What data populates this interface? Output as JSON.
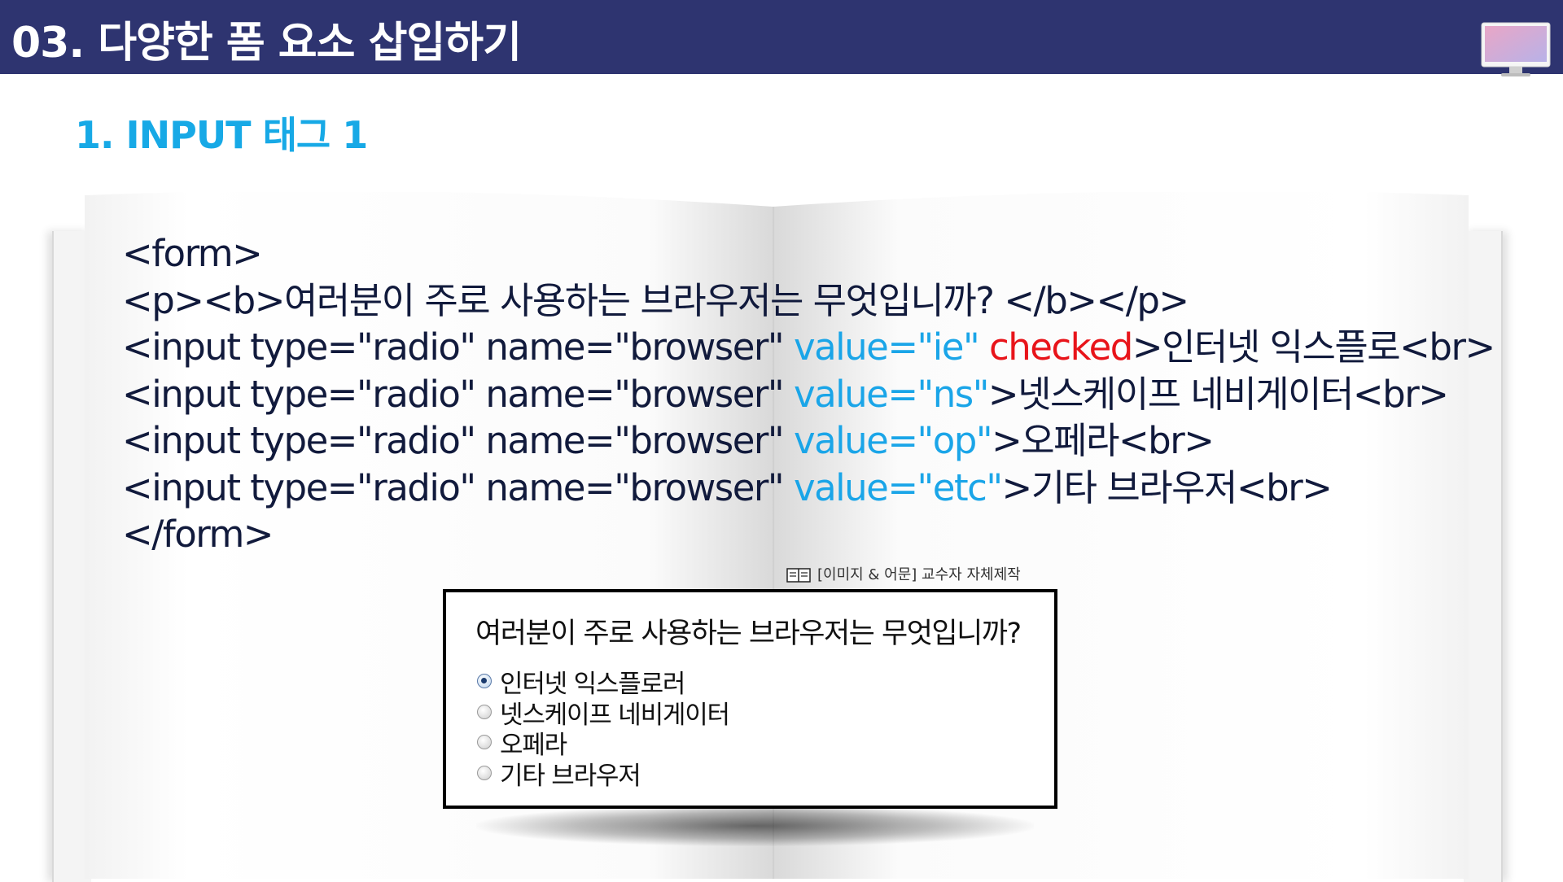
{
  "header": {
    "title": "03. 다양한 폼 요소 삽입하기",
    "icon": "monitor-icon"
  },
  "section": {
    "title": "1. INPUT 태그 1"
  },
  "code": {
    "line1": "<form>",
    "line2": "<p><b>여러분이 주로 사용하는 브라우저는 무엇입니까? </b></p>",
    "line3_a": "<input type=\"radio\" name=\"browser\" ",
    "line3_b": "value=\"ie\" ",
    "line3_c": "checked",
    "line3_d": ">인터넷 익스플로<br>",
    "line4_a": "<input type=\"radio\" name=\"browser\" ",
    "line4_b": "value=\"ns\"",
    "line4_c": ">넷스케이프 네비게이터<br>",
    "line5_a": "<input type=\"radio\" name=\"browser\" ",
    "line5_b": "value=\"op\"",
    "line5_c": ">오페라<br>",
    "line6_a": "<input type=\"radio\" name=\"browser\" ",
    "line6_b": "value=\"etc\"",
    "line6_c": ">기타 브라우저<br>",
    "line7": "</form>"
  },
  "credit": {
    "text": "[이미지 & 어문] 교수자 자체제작",
    "icon": "book-icon"
  },
  "demo": {
    "question": "여러분이 주로 사용하는 브라우저는 무엇입니까?",
    "options": [
      {
        "label": "인터넷 익스플로러",
        "checked": true
      },
      {
        "label": "넷스케이프 네비게이터",
        "checked": false
      },
      {
        "label": "오페라",
        "checked": false
      },
      {
        "label": "기타 브라우저",
        "checked": false
      }
    ]
  },
  "colors": {
    "header_bg": "#2e3470",
    "section_title": "#17a9e6",
    "code_text": "#111a3c",
    "code_highlight": "#1aa5e8",
    "code_checked": "#e8141a"
  }
}
